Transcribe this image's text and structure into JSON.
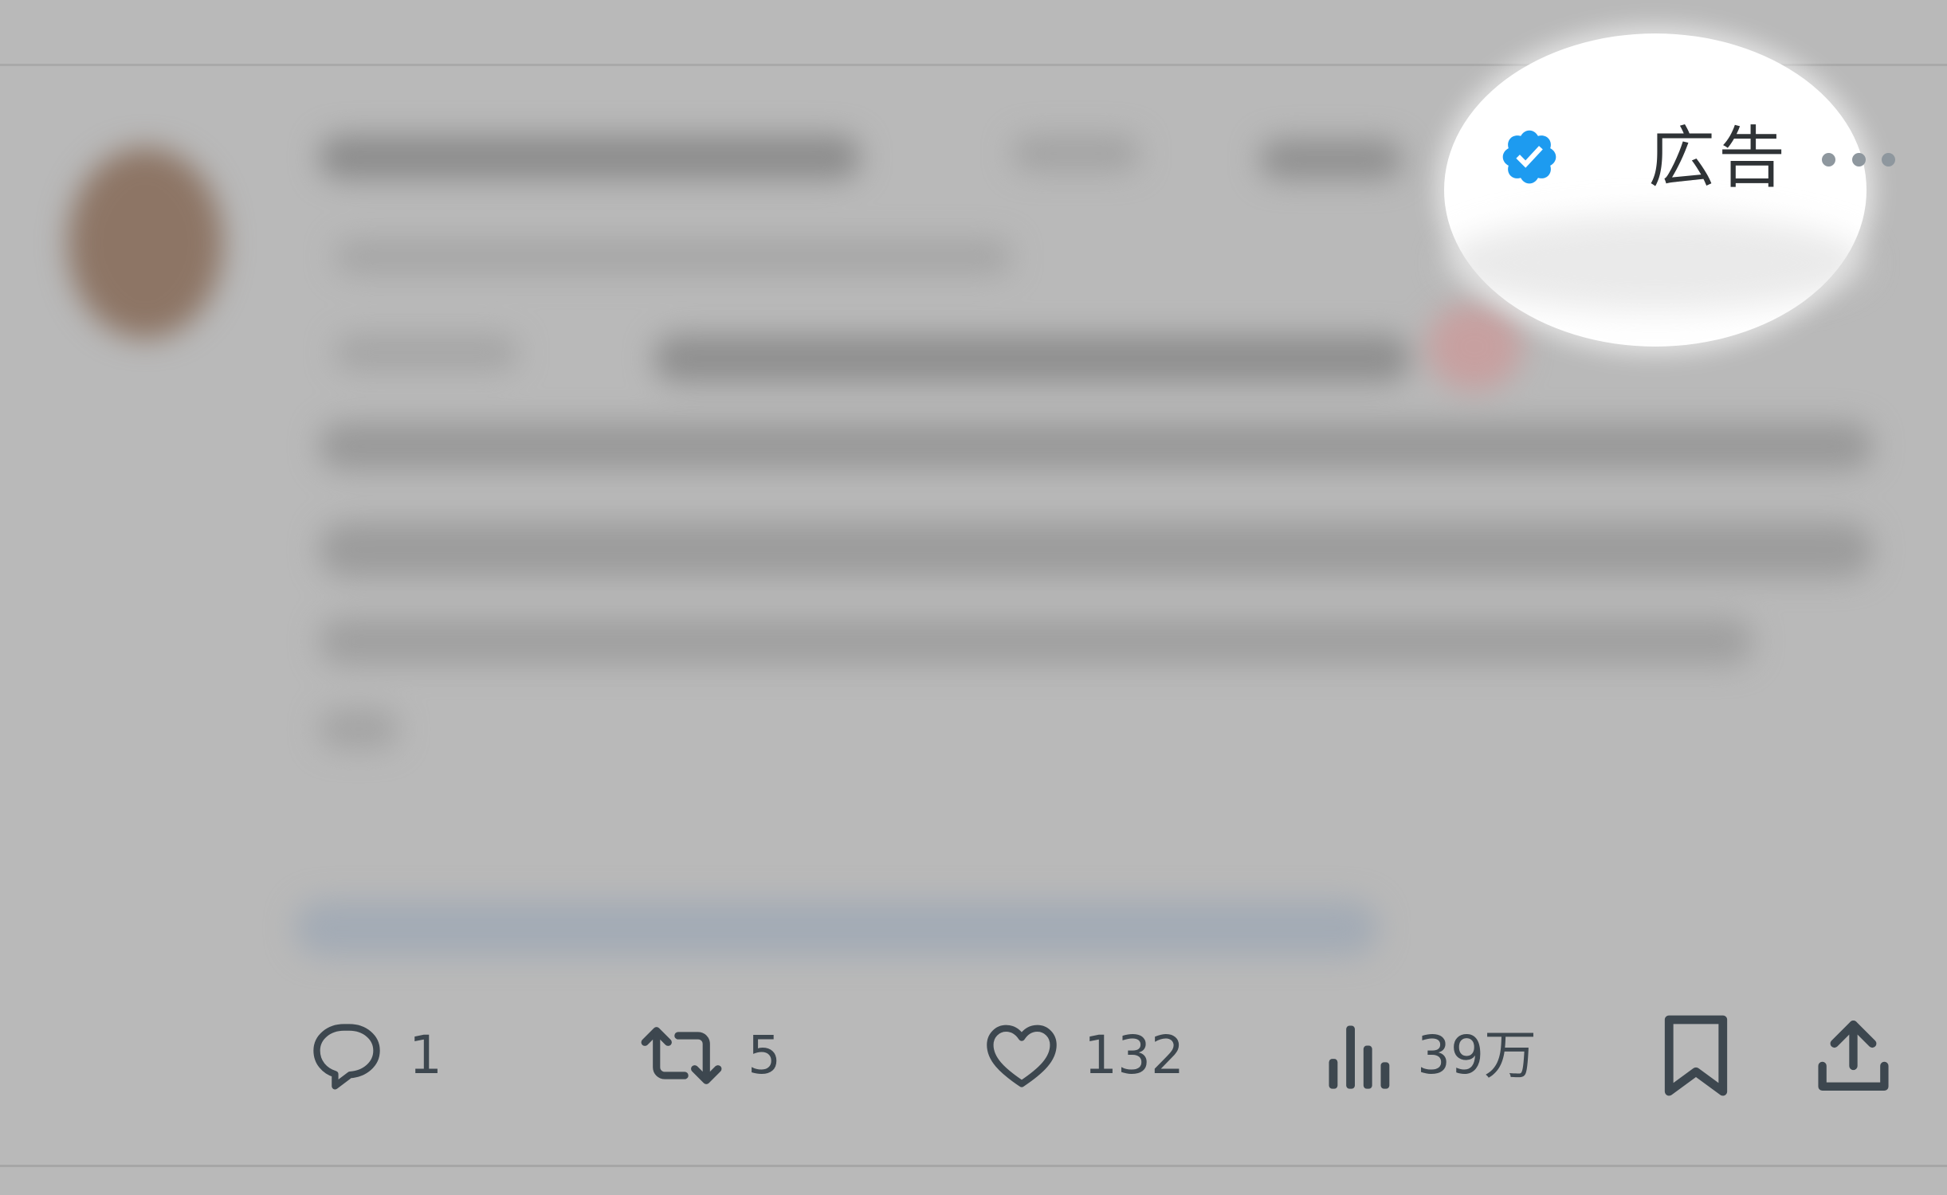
{
  "post": {
    "ad_label": "広告",
    "verified": true
  },
  "actions": {
    "reply_count": "1",
    "repost_count": "5",
    "like_count": "132",
    "views_count": "39万"
  },
  "icons": {
    "reply": "reply-icon",
    "repost": "repost-icon",
    "like": "heart-icon",
    "views": "views-chart-icon",
    "bookmark": "bookmark-icon",
    "share": "share-icon",
    "verified": "verified-badge-icon",
    "more": "more-dots-icon"
  },
  "colors": {
    "verified_blue": "#1d9bf0",
    "icon_gray": "#3d474f"
  }
}
